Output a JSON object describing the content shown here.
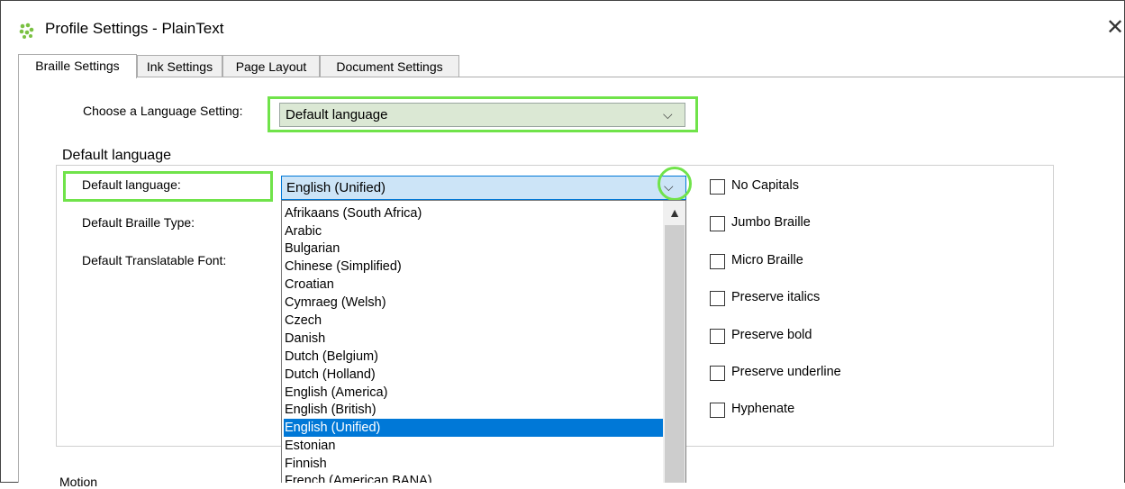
{
  "window": {
    "title": "Profile Settings - PlainText",
    "close_glyph": "✕"
  },
  "tabs": [
    {
      "label": "Braille Settings",
      "active": true
    },
    {
      "label": "Ink Settings",
      "active": false
    },
    {
      "label": "Page Layout",
      "active": false
    },
    {
      "label": "Document Settings",
      "active": false
    }
  ],
  "language_setting": {
    "label": "Choose a Language Setting:",
    "value": "Default language"
  },
  "group": {
    "legend": "Default language",
    "default_language_label": "Default language:",
    "default_braille_type_label": "Default Braille Type:",
    "default_font_label": "Default Translatable Font:"
  },
  "default_language_select": {
    "value": "English (Unified)",
    "options": [
      "Afrikaans (South Africa)",
      "Arabic",
      "Bulgarian",
      "Chinese (Simplified)",
      "Croatian",
      "Cymraeg (Welsh)",
      "Czech",
      "Danish",
      "Dutch (Belgium)",
      "Dutch (Holland)",
      "English (America)",
      "English (British)",
      "English (Unified)",
      "Estonian",
      "Finnish",
      "French (American BANA)"
    ],
    "selected_index": 12
  },
  "checkboxes": [
    {
      "label": "No Capitals",
      "checked": false
    },
    {
      "label": "Jumbo Braille",
      "checked": false
    },
    {
      "label": "Micro Braille",
      "checked": false
    },
    {
      "label": "Preserve italics",
      "checked": false
    },
    {
      "label": "Preserve bold",
      "checked": false
    },
    {
      "label": "Preserve underline",
      "checked": false
    },
    {
      "label": "Hyphenate",
      "checked": false
    }
  ],
  "bottom_section_label": "Motion",
  "colors": {
    "highlight": "#70e34a",
    "selection": "#0078d7",
    "app_icon": "#7ac142"
  }
}
